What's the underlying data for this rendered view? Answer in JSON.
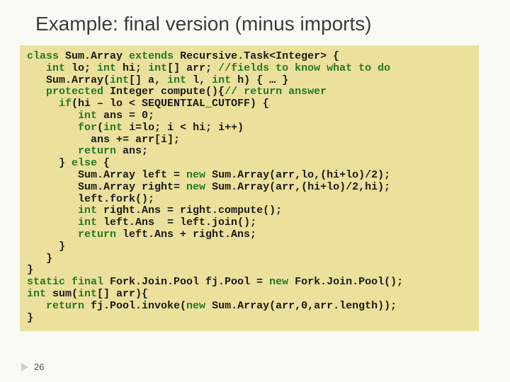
{
  "title": "Example: final version (minus imports)",
  "code": {
    "l01a": "class",
    "l01b": " Sum.Array ",
    "l01c": "extends",
    "l01d": " Recursive.Task<Integer> {",
    "l02a": "   int",
    "l02b": " lo; ",
    "l02c": "int",
    "l02d": " hi; ",
    "l02e": "int",
    "l02f": "[] arr; ",
    "l02g": "//fields to know what to do",
    "l03a": "   Sum.Array(",
    "l03b": "int",
    "l03c": "[] a, ",
    "l03d": "int",
    "l03e": " l, ",
    "l03f": "int",
    "l03g": " h) { … }",
    "l04a": "   protected",
    "l04b": " Integer compute(){",
    "l04c": "// return answer",
    "l05a": "     if",
    "l05b": "(hi – lo < SEQUENTIAL_CUTOFF) {",
    "l06a": "        int",
    "l06b": " ans = 0;",
    "l07a": "        for",
    "l07b": "(",
    "l07c": "int",
    "l07d": " i=lo; i < hi; i++)",
    "l08": "          ans += arr[i];",
    "l09a": "        return",
    "l09b": " ans;",
    "l10a": "     } ",
    "l10b": "else",
    "l10c": " {",
    "l11a": "        Sum.Array left = ",
    "l11b": "new",
    "l11c": " Sum.Array(arr,lo,(hi+lo)/2);",
    "l12a": "        Sum.Array right= ",
    "l12b": "new",
    "l12c": " Sum.Array(arr,(hi+lo)/2,hi);",
    "l13": "        left.fork();",
    "l14a": "        int",
    "l14b": " right.Ans = right.compute();",
    "l15a": "        int",
    "l15b": " left.Ans  = left.join();",
    "l16a": "        return",
    "l16b": " left.Ans + right.Ans;",
    "l17": "     }",
    "l18": "   }",
    "l19": "}",
    "l20a": "static final",
    "l20b": " Fork.Join.Pool fj.Pool = ",
    "l20c": "new",
    "l20d": " Fork.Join.Pool();",
    "l21a": "int",
    "l21b": " sum(",
    "l21c": "int",
    "l21d": "[] arr){",
    "l22a": "   return",
    "l22b": " fj.Pool.invoke(",
    "l22c": "new",
    "l22d": " Sum.Array(arr,0,arr.length));",
    "l23": "}"
  },
  "pagenum": "26"
}
